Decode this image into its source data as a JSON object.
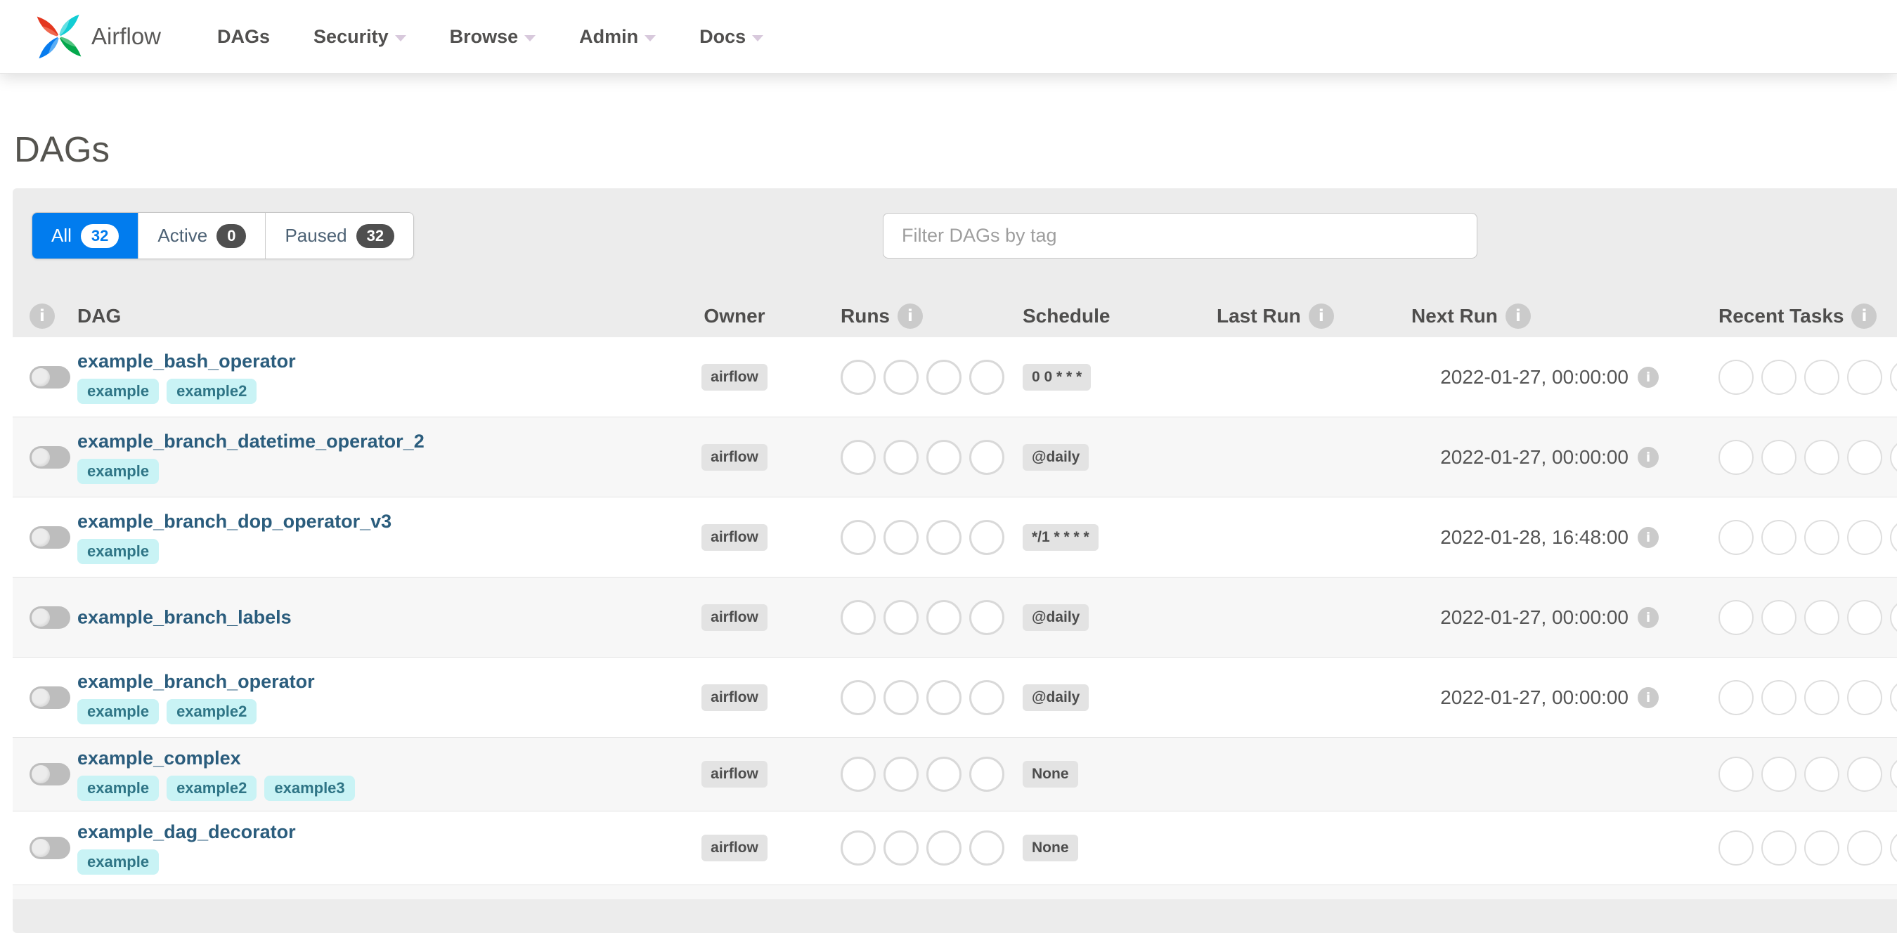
{
  "nav": {
    "brand": "Airflow",
    "items": [
      {
        "label": "DAGs",
        "caret": false
      },
      {
        "label": "Security",
        "caret": true
      },
      {
        "label": "Browse",
        "caret": true
      },
      {
        "label": "Admin",
        "caret": true
      },
      {
        "label": "Docs",
        "caret": true
      }
    ]
  },
  "page_title": "DAGs",
  "tabs": [
    {
      "label": "All",
      "count": "32",
      "active": true
    },
    {
      "label": "Active",
      "count": "0",
      "active": false
    },
    {
      "label": "Paused",
      "count": "32",
      "active": false
    }
  ],
  "filter": {
    "placeholder": "Filter DAGs by tag"
  },
  "table": {
    "headers": {
      "dag": "DAG",
      "owner": "Owner",
      "runs": "Runs",
      "schedule": "Schedule",
      "last_run": "Last Run",
      "next_run": "Next Run",
      "recent_tasks": "Recent Tasks"
    },
    "runs_slots": 4,
    "recent_task_slots": 5,
    "rows": [
      {
        "name": "example_bash_operator",
        "tags": [
          "example",
          "example2"
        ],
        "owner": "airflow",
        "schedule": "0 0 * * *",
        "last_run": "",
        "next_run": "2022-01-27, 00:00:00",
        "paused": true
      },
      {
        "name": "example_branch_datetime_operator_2",
        "tags": [
          "example"
        ],
        "owner": "airflow",
        "schedule": "@daily",
        "last_run": "",
        "next_run": "2022-01-27, 00:00:00",
        "paused": true
      },
      {
        "name": "example_branch_dop_operator_v3",
        "tags": [
          "example"
        ],
        "owner": "airflow",
        "schedule": "*/1 * * * *",
        "last_run": "",
        "next_run": "2022-01-28, 16:48:00",
        "paused": true
      },
      {
        "name": "example_branch_labels",
        "tags": [],
        "owner": "airflow",
        "schedule": "@daily",
        "last_run": "",
        "next_run": "2022-01-27, 00:00:00",
        "paused": true
      },
      {
        "name": "example_branch_operator",
        "tags": [
          "example",
          "example2"
        ],
        "owner": "airflow",
        "schedule": "@daily",
        "last_run": "",
        "next_run": "2022-01-27, 00:00:00",
        "paused": true
      },
      {
        "name": "example_complex",
        "tags": [
          "example",
          "example2",
          "example3"
        ],
        "owner": "airflow",
        "schedule": "None",
        "last_run": "",
        "next_run": "",
        "paused": true
      },
      {
        "name": "example_dag_decorator",
        "tags": [
          "example"
        ],
        "owner": "airflow",
        "schedule": "None",
        "last_run": "",
        "next_run": "",
        "paused": true
      }
    ]
  },
  "colors": {
    "accent_blue": "#017cee",
    "tag_bg": "#c9f3f5",
    "tag_text": "#2f7586",
    "dag_link": "#2b5d7d",
    "panel_bg": "#ececec",
    "badge_bg": "#e3e3e3",
    "logo_red": "#e4371f",
    "logo_teal": "#12cdd4",
    "logo_green": "#04a84c",
    "logo_blue": "#087cee"
  }
}
